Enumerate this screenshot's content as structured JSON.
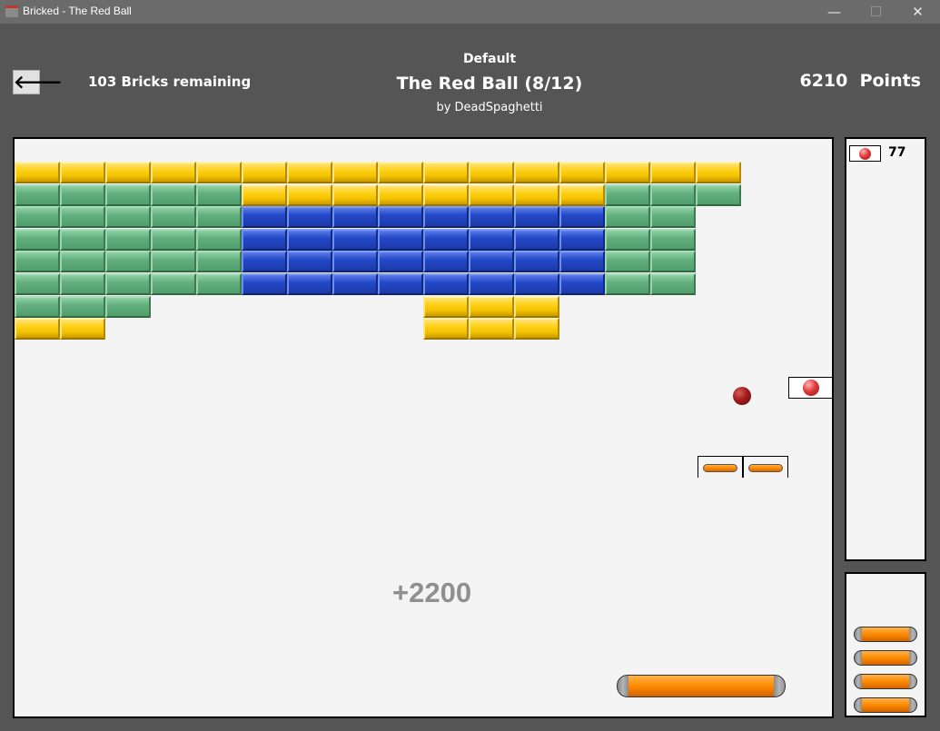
{
  "window": {
    "title": "Bricked - The Red Ball",
    "minimize_glyph": "—",
    "maximize_glyph": "☐",
    "close_glyph": "✕"
  },
  "header": {
    "back_glyph": "🡐",
    "bricks_remaining": "103 Bricks remaining",
    "level_pack": "Default",
    "level_name": "The Red Ball (8/12)",
    "author": "by DeadSpaghetti",
    "points": "6210  Points"
  },
  "game": {
    "combo_text": "+2200",
    "brick_colors": {
      "Y": "#ffd21a",
      "G": "#5fae7a",
      "B": "#2448c8"
    },
    "brick_rows": [
      "YYYYYYYYYYYYYYYY",
      "GGGGGYYYYYYYYGGG",
      "GGGGGBBBBBBBBGG.",
      "GGGGGBBBBBBBBGG.",
      "GGGGGBBBBBBBBGG.",
      "GGGGGBBBBBBBBGG.",
      "GGG......YYY....",
      "YY.......YYY...."
    ],
    "powerups": [
      "extra-ball",
      "paddle-extend",
      "paddle-extend"
    ]
  },
  "sidebar": {
    "lives_count": "77",
    "spare_paddles": 4
  }
}
